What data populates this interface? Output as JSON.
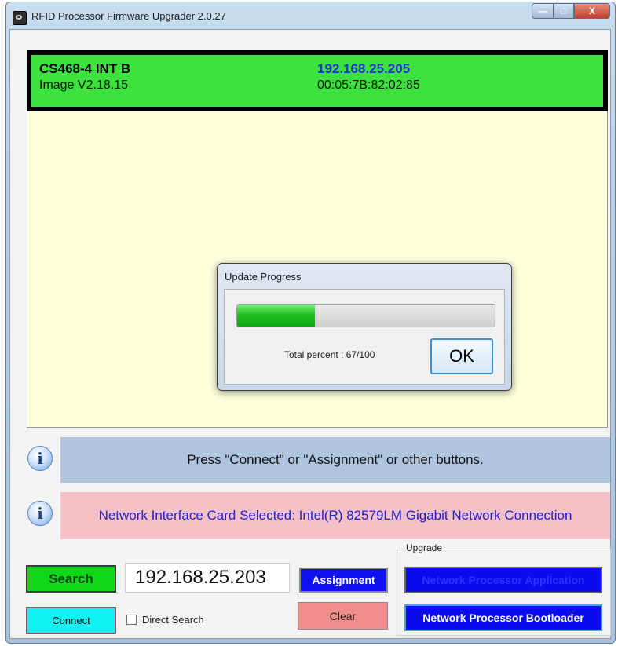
{
  "window": {
    "title": "RFID Processor Firmware Upgrader 2.0.27",
    "controls": {
      "minimize": "—",
      "maximize": "□",
      "close": "X"
    }
  },
  "device": {
    "name": "CS468-4 INT B",
    "image": "Image V2.18.15",
    "ip": "192.168.25.205",
    "mac": "00:05:7B:82:02:85"
  },
  "dialog": {
    "title": "Update Progress",
    "progress_percent": 67,
    "progress_text": "Total percent : 67/100",
    "ok_label": "OK"
  },
  "info": {
    "message_1": "Press \"Connect\" or \"Assignment\" or other buttons.",
    "message_2": "Network Interface Card Selected: Intel(R) 82579LM Gigabit Network Connection",
    "icon_glyph": "i"
  },
  "controls": {
    "search_label": "Search",
    "ip_value": "192.168.25.203",
    "assignment_label": "Assignment",
    "connect_label": "Connect",
    "direct_search_label": "Direct Search",
    "clear_label": "Clear"
  },
  "upgrade": {
    "legend": "Upgrade",
    "app_label": "Network Processor Application",
    "bootloader_label": "Network Processor Bootloader"
  },
  "colors": {
    "device_card": "#3ee23e",
    "ip_text": "#1e34d6",
    "info_bar_blue": "#afc4de",
    "info_bar_pink": "#f5c0c6",
    "search_button": "#0fd81a",
    "connect_button": "#11f3f3",
    "clear_button": "#f28d8d",
    "upgrade_button": "#0b0bf0"
  }
}
